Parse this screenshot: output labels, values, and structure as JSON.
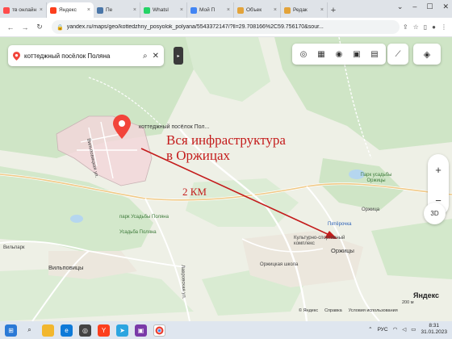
{
  "browser": {
    "tabs": [
      {
        "label": "тв онлайн",
        "color": "#ff4b4b"
      },
      {
        "label": "Яндекс",
        "color": "#fc3f1d",
        "active": true
      },
      {
        "label": "Пе",
        "color": "#4a76a8"
      },
      {
        "label": "Whatsl",
        "color": "#25d366"
      },
      {
        "label": "Мой П",
        "color": "#4285f4"
      },
      {
        "label": "Объек",
        "color": "#e3a33a"
      },
      {
        "label": "Редак",
        "color": "#e3a33a"
      }
    ],
    "new_tab": "+",
    "url": "yandex.ru/maps/geo/kottedzhny_posyolok_polyana/5543372147/?ll=29.708166%2C59.756170&sour..."
  },
  "map": {
    "search": {
      "value": "коттеджный посёлок Поляна"
    },
    "place_label": "коттеджный посёлок Пол...",
    "annotation": {
      "line1": "Вся инфраструктура",
      "line2": "в Оржицах",
      "distance": "2 КМ"
    },
    "labels": {
      "kolodesnaya": "Вильповицкая ул.",
      "park_polyana": "парк Усадьбы Поляна",
      "usadba_polyana": "Усадьба Поляна",
      "vilpovitsy": "Вильповицы",
      "vilpark": "Вильпарк",
      "park_orzhitsy": "Парк усадьбы Оржицы",
      "orzhitsy_poi": "Оржица",
      "pyaterochka": "Пятёрочка",
      "sport_complex": "Культурно-спортивный комплекс",
      "school": "Оржицкая школа",
      "orzhitsy": "Оржицы",
      "lavrovka": "Лавровская ул."
    },
    "footer": {
      "copyright": "© Яндекс",
      "links": [
        "Справка",
        "Условия использования"
      ],
      "scale": "200 м",
      "logo": "Яндекс"
    }
  },
  "taskbar": {
    "lang": "РУС",
    "time": "8:31",
    "date": "31.01.2023"
  }
}
